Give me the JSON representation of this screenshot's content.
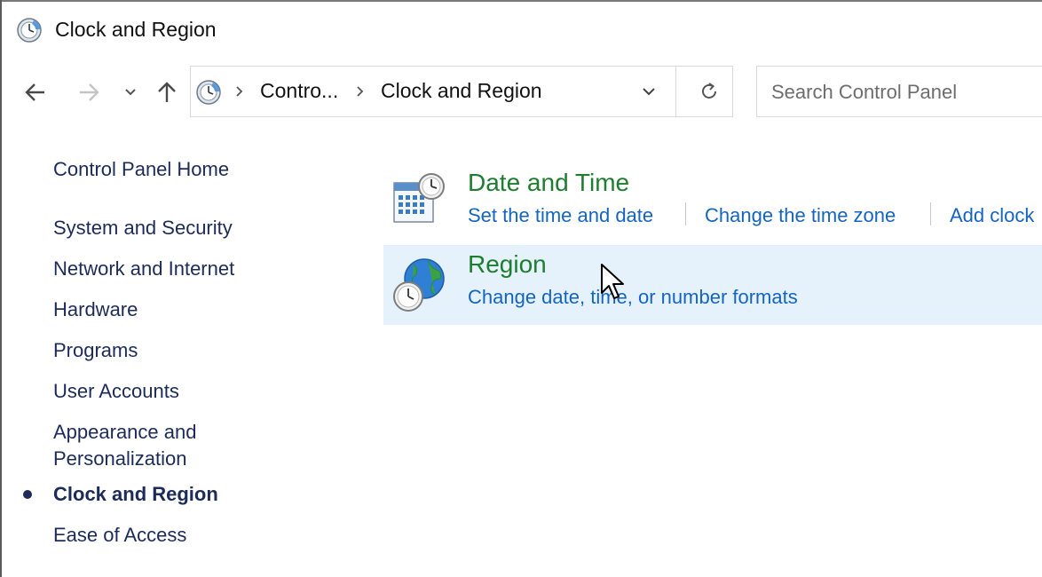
{
  "window": {
    "title": "Clock and Region"
  },
  "navbar": {
    "back_icon": "back-arrow-icon",
    "forward_icon": "forward-arrow-icon",
    "recent_icon": "chevron-down-icon",
    "up_icon": "up-arrow-icon",
    "breadcrumbs": [
      "Contro...",
      "Clock and Region"
    ],
    "refresh_icon": "refresh-icon"
  },
  "search": {
    "placeholder": "Search Control Panel",
    "value": ""
  },
  "sidebar": {
    "home": "Control Panel Home",
    "items": [
      {
        "label": "System and Security",
        "current": false
      },
      {
        "label": "Network and Internet",
        "current": false
      },
      {
        "label": "Hardware",
        "current": false
      },
      {
        "label": "Programs",
        "current": false
      },
      {
        "label": "User Accounts",
        "current": false
      },
      {
        "label": "Appearance and",
        "label2": "Personalization",
        "current": false
      },
      {
        "label": "Clock and Region",
        "current": true
      },
      {
        "label": "Ease of Access",
        "current": false
      }
    ]
  },
  "categories": [
    {
      "title": "Date and Time",
      "icon": "calendar-clock-icon",
      "links": [
        "Set the time and date",
        "Change the time zone",
        "Add clock"
      ]
    },
    {
      "title": "Region",
      "icon": "globe-clock-icon",
      "links": [
        "Change date, time, or number formats"
      ]
    }
  ],
  "colors": {
    "category_title": "#1e7d2f",
    "link": "#1565c0",
    "sidebar_text": "#1c2b59",
    "hover_bg": "#e5f1fb"
  }
}
